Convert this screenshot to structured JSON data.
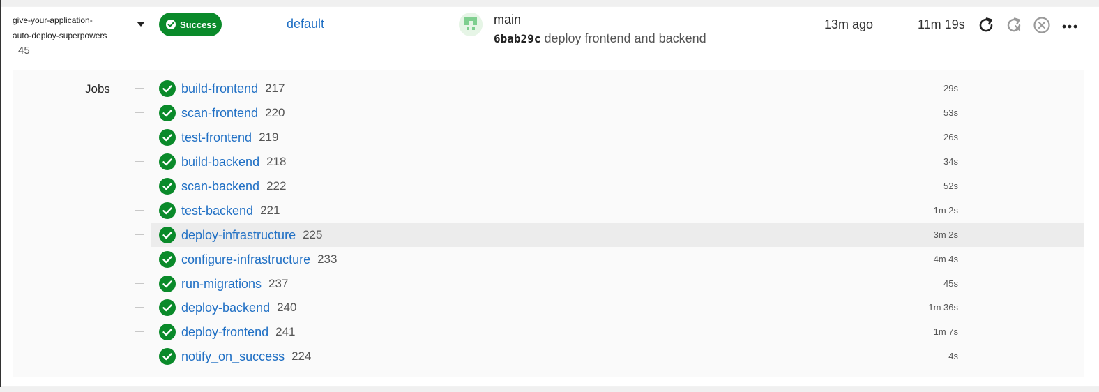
{
  "pipeline": {
    "project_line1": "give-your-application-",
    "project_line2": "auto-deploy-superpowers",
    "number": "45",
    "status": "Success",
    "context": "default",
    "branch": "main",
    "commit_sha": "6bab29c",
    "commit_message": "deploy frontend and backend",
    "started": "13m ago",
    "duration": "11m 19s"
  },
  "jobs_label": "Jobs",
  "jobs": [
    {
      "name": "build-frontend",
      "number": "217",
      "duration": "29s"
    },
    {
      "name": "scan-frontend",
      "number": "220",
      "duration": "53s"
    },
    {
      "name": "test-frontend",
      "number": "219",
      "duration": "26s"
    },
    {
      "name": "build-backend",
      "number": "218",
      "duration": "34s"
    },
    {
      "name": "scan-backend",
      "number": "222",
      "duration": "52s"
    },
    {
      "name": "test-backend",
      "number": "221",
      "duration": "1m 2s"
    },
    {
      "name": "deploy-infrastructure",
      "number": "225",
      "duration": "3m 2s"
    },
    {
      "name": "configure-infrastructure",
      "number": "233",
      "duration": "4m 4s"
    },
    {
      "name": "run-migrations",
      "number": "237",
      "duration": "45s"
    },
    {
      "name": "deploy-backend",
      "number": "240",
      "duration": "1m 36s"
    },
    {
      "name": "deploy-frontend",
      "number": "241",
      "duration": "1m 7s"
    },
    {
      "name": "notify_on_success",
      "number": "224",
      "duration": "4s"
    }
  ],
  "colors": {
    "success": "#0a8a2a",
    "link": "#1f6fc4",
    "row_highlight": "#ececec"
  },
  "icons": [
    "chevron-down-icon",
    "check-circle-icon",
    "avatar-icon",
    "rerun-icon",
    "rerun-failed-icon",
    "cancel-icon",
    "more-icon"
  ]
}
